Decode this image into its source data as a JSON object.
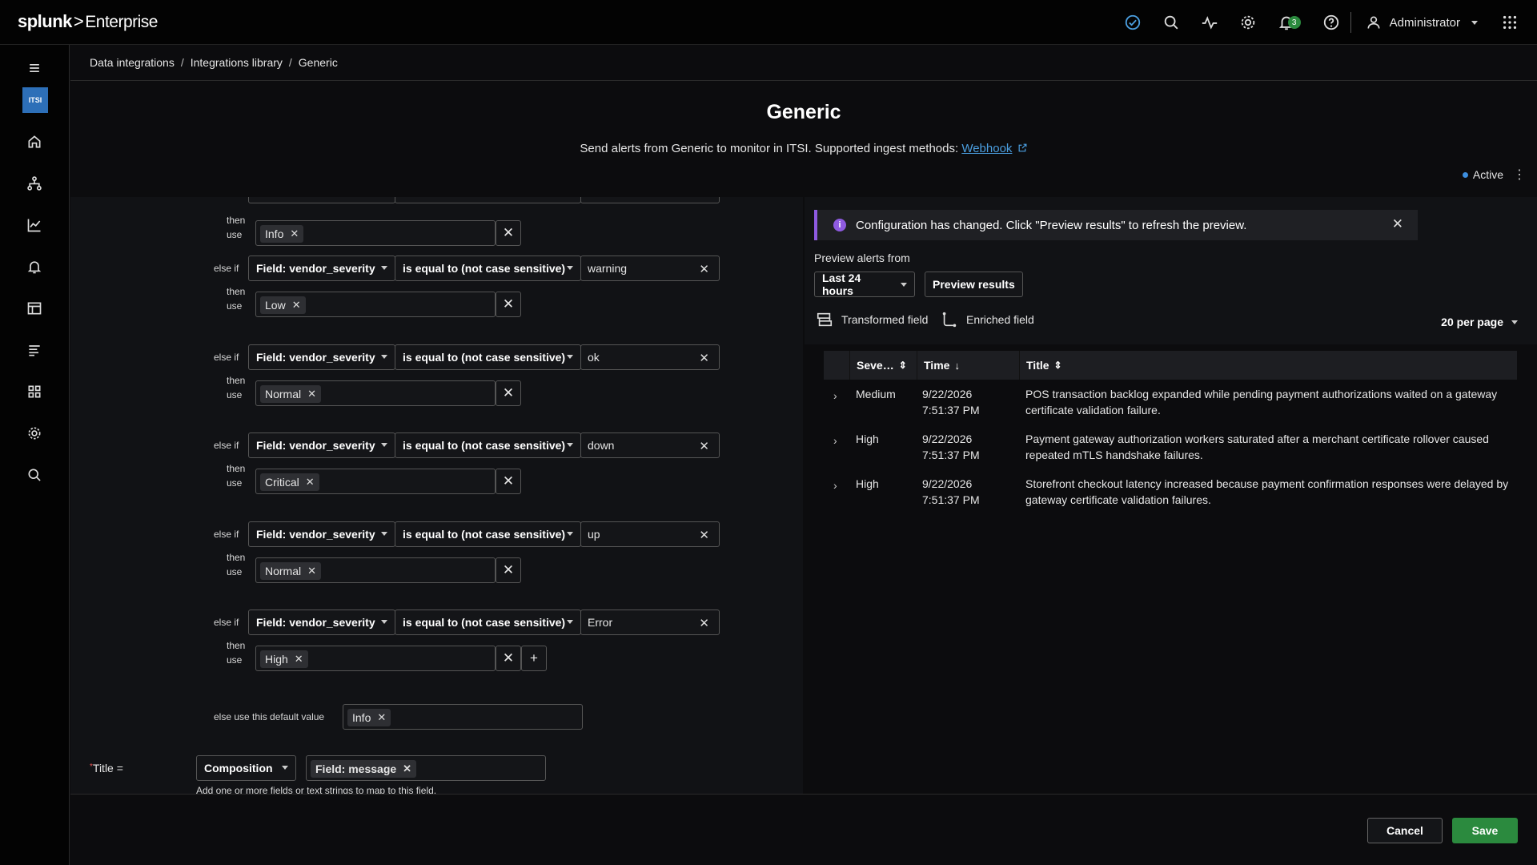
{
  "header": {
    "logo_brand": "splunk",
    "logo_sep": ">",
    "logo_product": "Enterprise",
    "user_name": "Administrator",
    "notification_count": "3",
    "icons": [
      "health-check-icon",
      "search-icon",
      "activity-icon",
      "gear-icon",
      "bell-icon",
      "help-icon",
      "user-icon",
      "apps-grid-icon"
    ]
  },
  "sidebar": {
    "app_badge": "ITSI",
    "items": [
      "menu-icon",
      "home-icon",
      "service-tree-icon",
      "chart-icon",
      "bell-icon",
      "layout-icon",
      "list-icon",
      "apps-icon",
      "gear-icon",
      "search-icon"
    ]
  },
  "breadcrumb": {
    "items": [
      "Data integrations",
      "Integrations library",
      "Generic"
    ],
    "sep": "/"
  },
  "page": {
    "title": "Generic",
    "subtitle_prefix": "Send alerts from Generic to monitor in ITSI. Supported ingest methods:",
    "subtitle_link": "Webhook",
    "status": "Active"
  },
  "rules": {
    "else_if_label": "else if",
    "then_label_1": "then",
    "then_label_2": "use",
    "first_then_value": "Info",
    "rows": [
      {
        "field": "Field: vendor_severity",
        "op": "is equal to (not case sensitive)",
        "value": "warning",
        "then": "Low"
      },
      {
        "field": "Field: vendor_severity",
        "op": "is equal to (not case sensitive)",
        "value": "ok",
        "then": "Normal"
      },
      {
        "field": "Field: vendor_severity",
        "op": "is equal to (not case sensitive)",
        "value": "down",
        "then": "Critical"
      },
      {
        "field": "Field: vendor_severity",
        "op": "is equal to (not case sensitive)",
        "value": "up",
        "then": "Normal"
      },
      {
        "field": "Field: vendor_severity",
        "op": "is equal to (not case sensitive)",
        "value": "Error",
        "then": "High"
      }
    ],
    "default_label": "else use this default value",
    "default_value": "Info"
  },
  "title_field": {
    "required_mark": "*",
    "label": "Title =",
    "mode": "Composition",
    "chip": "Field: message",
    "helper": "Add one or more fields or text strings to map to this field."
  },
  "preview": {
    "banner": "Configuration has changed. Click \"Preview results\" to refresh the preview.",
    "from_label": "Preview alerts from",
    "range": "Last 24 hours",
    "preview_button": "Preview results",
    "legend_transformed": "Transformed field",
    "legend_enriched": "Enriched field",
    "per_page": "20 per page",
    "columns": [
      "Seve…",
      "Time",
      "Title"
    ],
    "rows": [
      {
        "severity": "Medium",
        "date": "9/22/2026",
        "time": "7:51:37 PM",
        "title": "POS transaction backlog expanded while pending payment authorizations waited on a gateway certificate validation failure."
      },
      {
        "severity": "High",
        "date": "9/22/2026",
        "time": "7:51:37 PM",
        "title": "Payment gateway authorization workers saturated after a merchant certificate rollover caused repeated mTLS handshake failures."
      },
      {
        "severity": "High",
        "date": "9/22/2026",
        "time": "7:51:37 PM",
        "title": "Storefront checkout latency increased because payment confirmation responses were delayed by gateway certificate validation failures."
      }
    ]
  },
  "footer": {
    "cancel": "Cancel",
    "save": "Save"
  },
  "colors": {
    "accent_green": "#2b8a3e",
    "link_blue": "#4b9fe0",
    "banner_purple": "#8e5ae0",
    "status_blue": "#3d8fe0"
  }
}
